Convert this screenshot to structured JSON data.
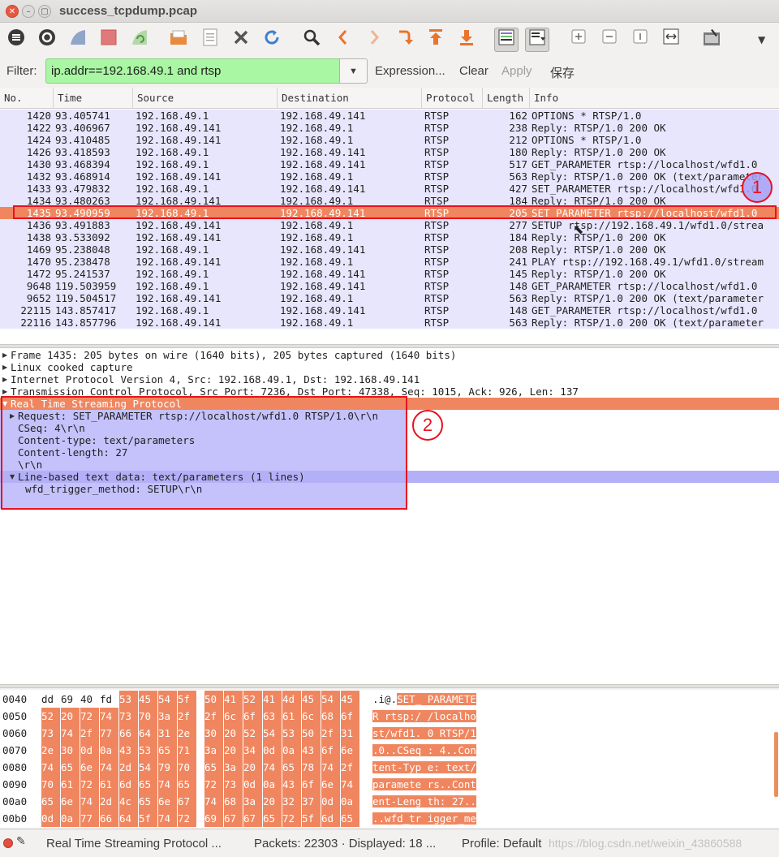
{
  "window": {
    "title": "success_tcpdump.pcap"
  },
  "filter": {
    "label": "Filter:",
    "value": "ip.addr==192.168.49.1 and rtsp",
    "expression": "Expression...",
    "clear": "Clear",
    "apply": "Apply",
    "save": "保存"
  },
  "columns": [
    "No.",
    "Time",
    "Source",
    "Destination",
    "Protocol",
    "Length",
    "Info"
  ],
  "packets": [
    {
      "no": "1420",
      "time": "93.405741",
      "src": "192.168.49.1",
      "dst": "192.168.49.141",
      "proto": "RTSP",
      "len": "162",
      "info": "OPTIONS * RTSP/1.0"
    },
    {
      "no": "1422",
      "time": "93.406967",
      "src": "192.168.49.141",
      "dst": "192.168.49.1",
      "proto": "RTSP",
      "len": "238",
      "info": "Reply: RTSP/1.0 200 OK"
    },
    {
      "no": "1424",
      "time": "93.410485",
      "src": "192.168.49.141",
      "dst": "192.168.49.1",
      "proto": "RTSP",
      "len": "212",
      "info": "OPTIONS * RTSP/1.0"
    },
    {
      "no": "1426",
      "time": "93.418593",
      "src": "192.168.49.1",
      "dst": "192.168.49.141",
      "proto": "RTSP",
      "len": "180",
      "info": "Reply: RTSP/1.0 200 OK"
    },
    {
      "no": "1430",
      "time": "93.468394",
      "src": "192.168.49.1",
      "dst": "192.168.49.141",
      "proto": "RTSP",
      "len": "517",
      "info": "GET_PARAMETER rtsp://localhost/wfd1.0"
    },
    {
      "no": "1432",
      "time": "93.468914",
      "src": "192.168.49.141",
      "dst": "192.168.49.1",
      "proto": "RTSP",
      "len": "563",
      "info": "Reply: RTSP/1.0 200 OK (text/parameter"
    },
    {
      "no": "1433",
      "time": "93.479832",
      "src": "192.168.49.1",
      "dst": "192.168.49.141",
      "proto": "RTSP",
      "len": "427",
      "info": "SET_PARAMETER rtsp://localhost/wfd1.0"
    },
    {
      "no": "1434",
      "time": "93.480263",
      "src": "192.168.49.141",
      "dst": "192.168.49.1",
      "proto": "RTSP",
      "len": "184",
      "info": "Reply: RTSP/1.0 200 OK"
    },
    {
      "no": "1435",
      "time": "93.490959",
      "src": "192.168.49.1",
      "dst": "192.168.49.141",
      "proto": "RTSP",
      "len": "205",
      "info": "SET_PARAMETER rtsp://localhost/wfd1.0"
    },
    {
      "no": "1436",
      "time": "93.491883",
      "src": "192.168.49.141",
      "dst": "192.168.49.1",
      "proto": "RTSP",
      "len": "277",
      "info": "SETUP rtsp://192.168.49.1/wfd1.0/strea"
    },
    {
      "no": "1438",
      "time": "93.533092",
      "src": "192.168.49.141",
      "dst": "192.168.49.1",
      "proto": "RTSP",
      "len": "184",
      "info": "Reply: RTSP/1.0 200 OK"
    },
    {
      "no": "1469",
      "time": "95.238048",
      "src": "192.168.49.1",
      "dst": "192.168.49.141",
      "proto": "RTSP",
      "len": "208",
      "info": "Reply: RTSP/1.0 200 OK"
    },
    {
      "no": "1470",
      "time": "95.238478",
      "src": "192.168.49.141",
      "dst": "192.168.49.1",
      "proto": "RTSP",
      "len": "241",
      "info": "PLAY rtsp://192.168.49.1/wfd1.0/stream"
    },
    {
      "no": "1472",
      "time": "95.241537",
      "src": "192.168.49.1",
      "dst": "192.168.49.141",
      "proto": "RTSP",
      "len": "145",
      "info": "Reply: RTSP/1.0 200 OK"
    },
    {
      "no": "9648",
      "time": "119.503959",
      "src": "192.168.49.1",
      "dst": "192.168.49.141",
      "proto": "RTSP",
      "len": "148",
      "info": "GET_PARAMETER rtsp://localhost/wfd1.0"
    },
    {
      "no": "9652",
      "time": "119.504517",
      "src": "192.168.49.141",
      "dst": "192.168.49.1",
      "proto": "RTSP",
      "len": "563",
      "info": "Reply: RTSP/1.0 200 OK (text/parameter"
    },
    {
      "no": "22115",
      "time": "143.857417",
      "src": "192.168.49.1",
      "dst": "192.168.49.141",
      "proto": "RTSP",
      "len": "148",
      "info": "GET_PARAMETER rtsp://localhost/wfd1.0"
    },
    {
      "no": "22116",
      "time": "143.857796",
      "src": "192.168.49.141",
      "dst": "192.168.49.1",
      "proto": "RTSP",
      "len": "563",
      "info": "Reply: RTSP/1.0 200 OK (text/parameter"
    }
  ],
  "selected_packet": "1435",
  "annotations": {
    "one": "1",
    "two": "2"
  },
  "details": [
    {
      "text": "Frame 1435: 205 bytes on wire (1640 bits), 205 bytes captured (1640 bits)",
      "level": 0,
      "arrow": "right"
    },
    {
      "text": "Linux cooked capture",
      "level": 0,
      "arrow": "right"
    },
    {
      "text": "Internet Protocol Version 4, Src: 192.168.49.1, Dst: 192.168.49.141",
      "level": 0,
      "arrow": "right"
    },
    {
      "text": "Transmission Control Protocol, Src Port: 7236, Dst Port: 47338, Seq: 1015, Ack: 926, Len: 137",
      "level": 0,
      "arrow": "right"
    },
    {
      "text": "Real Time Streaming Protocol",
      "level": 0,
      "arrow": "down",
      "highlight": true
    },
    {
      "text": "Request: SET_PARAMETER rtsp://localhost/wfd1.0 RTSP/1.0\\r\\n",
      "level": 1,
      "arrow": "right"
    },
    {
      "text": "CSeq: 4\\r\\n",
      "level": 1,
      "arrow": ""
    },
    {
      "text": "Content-type: text/parameters",
      "level": 1,
      "arrow": ""
    },
    {
      "text": "Content-length: 27",
      "level": 1,
      "arrow": ""
    },
    {
      "text": "\\r\\n",
      "level": 1,
      "arrow": ""
    },
    {
      "text": "Line-based text data: text/parameters (1 lines)",
      "level": 1,
      "arrow": "down",
      "subhead": true
    },
    {
      "text": "wfd_trigger_method: SETUP\\r\\n",
      "level": 2,
      "arrow": ""
    }
  ],
  "hex": [
    {
      "offset": "0040",
      "bytes": [
        "dd",
        "69",
        "40",
        "fd",
        "53",
        "45",
        "54",
        "5f",
        "50",
        "41",
        "52",
        "41",
        "4d",
        "45",
        "54",
        "45"
      ],
      "hl_from": 4,
      "ascii_plain": ".i@.",
      "ascii_hl": "SET_ PARAMETE"
    },
    {
      "offset": "0050",
      "bytes": [
        "52",
        "20",
        "72",
        "74",
        "73",
        "70",
        "3a",
        "2f",
        "2f",
        "6c",
        "6f",
        "63",
        "61",
        "6c",
        "68",
        "6f"
      ],
      "hl_from": 0,
      "ascii_plain": "",
      "ascii_hl": "R rtsp:/ /localho"
    },
    {
      "offset": "0060",
      "bytes": [
        "73",
        "74",
        "2f",
        "77",
        "66",
        "64",
        "31",
        "2e",
        "30",
        "20",
        "52",
        "54",
        "53",
        "50",
        "2f",
        "31"
      ],
      "hl_from": 0,
      "ascii_plain": "",
      "ascii_hl": "st/wfd1. 0 RTSP/1"
    },
    {
      "offset": "0070",
      "bytes": [
        "2e",
        "30",
        "0d",
        "0a",
        "43",
        "53",
        "65",
        "71",
        "3a",
        "20",
        "34",
        "0d",
        "0a",
        "43",
        "6f",
        "6e"
      ],
      "hl_from": 0,
      "ascii_plain": "",
      "ascii_hl": ".0..CSeq : 4..Con"
    },
    {
      "offset": "0080",
      "bytes": [
        "74",
        "65",
        "6e",
        "74",
        "2d",
        "54",
        "79",
        "70",
        "65",
        "3a",
        "20",
        "74",
        "65",
        "78",
        "74",
        "2f"
      ],
      "hl_from": 0,
      "ascii_plain": "",
      "ascii_hl": "tent-Typ e: text/"
    },
    {
      "offset": "0090",
      "bytes": [
        "70",
        "61",
        "72",
        "61",
        "6d",
        "65",
        "74",
        "65",
        "72",
        "73",
        "0d",
        "0a",
        "43",
        "6f",
        "6e",
        "74"
      ],
      "hl_from": 0,
      "ascii_plain": "",
      "ascii_hl": "paramete rs..Cont"
    },
    {
      "offset": "00a0",
      "bytes": [
        "65",
        "6e",
        "74",
        "2d",
        "4c",
        "65",
        "6e",
        "67",
        "74",
        "68",
        "3a",
        "20",
        "32",
        "37",
        "0d",
        "0a"
      ],
      "hl_from": 0,
      "ascii_plain": "",
      "ascii_hl": "ent-Leng th: 27.."
    },
    {
      "offset": "00b0",
      "bytes": [
        "0d",
        "0a",
        "77",
        "66",
        "64",
        "5f",
        "74",
        "72",
        "69",
        "67",
        "67",
        "65",
        "72",
        "5f",
        "6d",
        "65"
      ],
      "hl_from": 0,
      "ascii_plain": "",
      "ascii_hl": "..wfd_tr igger_me"
    }
  ],
  "status": {
    "field": "Real Time Streaming Protocol ...",
    "packets": "Packets: 22303 · Displayed: 18 ...",
    "profile": "Profile: Default",
    "watermark": "https://blog.csdn.net/weixin_43860588"
  },
  "colors": {
    "selected": "#f0865f",
    "row_bg": "#e8e6fd",
    "filter_ok": "#a9f6a3",
    "annotation": "#e8121f"
  },
  "toolbar_icons": [
    "interfaces-icon",
    "options-icon",
    "start-capture-icon",
    "stop-capture-icon",
    "restart-capture-icon",
    "open-file-icon",
    "save-file-icon",
    "close-file-icon",
    "reload-icon",
    "find-icon",
    "back-icon",
    "forward-icon",
    "goto-packet-icon",
    "first-packet-icon",
    "last-packet-icon",
    "colorize-icon",
    "autoscroll-icon",
    "zoom-in-icon",
    "zoom-out-icon",
    "normal-size-icon",
    "resize-columns-icon",
    "prefs-icon"
  ]
}
